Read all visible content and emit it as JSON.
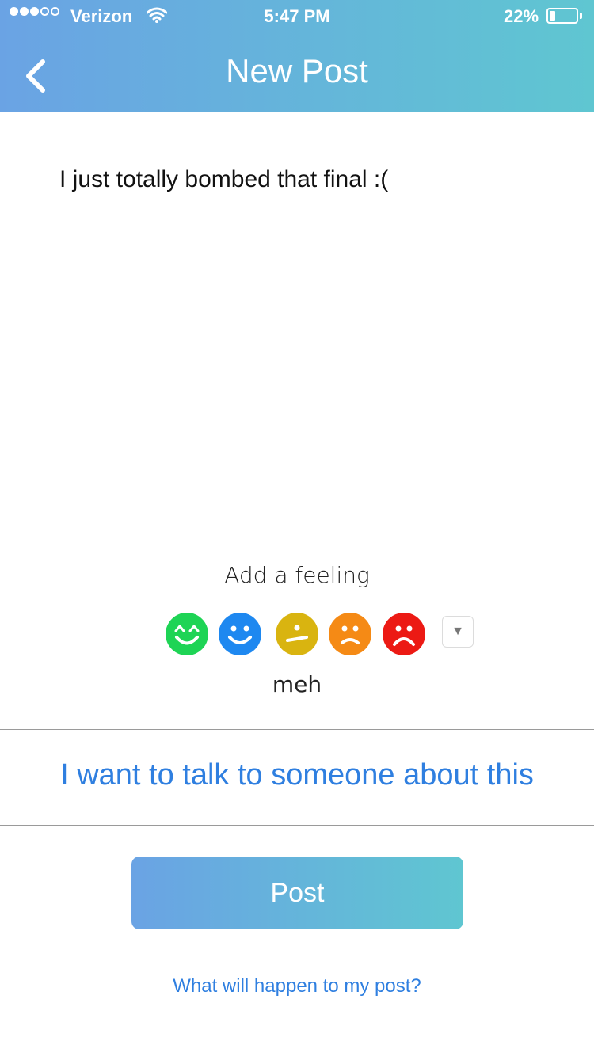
{
  "status_bar": {
    "signal_bars": [
      true,
      true,
      true,
      false,
      false
    ],
    "carrier": "Verizon",
    "time": "5:47 PM",
    "battery_percent": "22%",
    "battery_level": 0.22
  },
  "header": {
    "title": "New Post",
    "back_icon": "chevron-left-icon",
    "gradient_start": "#6aa3e4",
    "gradient_end": "#5fc6d1"
  },
  "post": {
    "text": "I just totally bombed that final :("
  },
  "feeling": {
    "label": "Add a feeling",
    "faces": [
      {
        "name": "very-happy-face-icon",
        "color": "#1ed455"
      },
      {
        "name": "happy-face-icon",
        "color": "#1e88f0"
      },
      {
        "name": "meh-face-icon",
        "color": "#d9b410"
      },
      {
        "name": "sad-face-icon",
        "color": "#f58a15"
      },
      {
        "name": "very-sad-face-icon",
        "color": "#ec1a14"
      }
    ],
    "expand_icon": "triangle-down-icon",
    "selected": "meh"
  },
  "actions": {
    "talk_label": "I want to talk to someone about this",
    "post_label": "Post",
    "help_link": "What will happen to my post?",
    "link_color": "#2f7fe0"
  }
}
